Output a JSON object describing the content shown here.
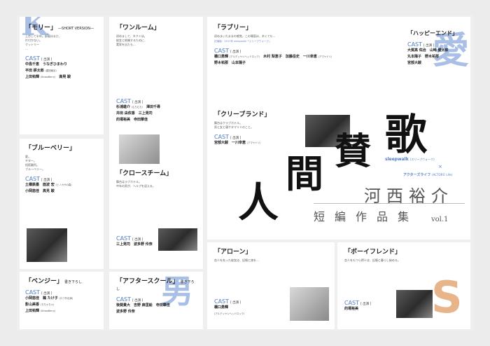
{
  "colors": {
    "accent": "#4f7cc8",
    "ghost_blue": "#a9bfe6",
    "ghost_peach": "#e8b48a"
  },
  "panels": {
    "mori": {
      "title": "「モリー」",
      "tag": "―SHORT VERSION―",
      "text": [
        "上京して半年。部屋はまだ、",
        "片付かない。",
        "クットリー",
        "…"
      ],
      "cast_label": "CAST",
      "cast_tag": "[ 出演 ]",
      "cast": [
        {
          "name": "中島千恵　うなぎひまわり"
        },
        {
          "name": "平田 耕太郎",
          "role": "(劇団東京)"
        },
        {
          "name": "上田祐輝",
          "role": "(StrawBerry)",
          "name2": "高晃 駿"
        }
      ]
    },
    "blueberry": {
      "title": "「ブルーベリー」",
      "text": [
        "夏。",
        "ギター。",
        "短距離列。",
        "ブルーベリー。"
      ],
      "cast_label": "CAST",
      "cast_tag": "[ 出演 ]",
      "cast": [
        {
          "name": "土橋鉄墨",
          "name2": "面波 宏",
          "role": "(ヒノカサの森)"
        },
        {
          "name": "小岡悠佳",
          "name2": "高見 駿"
        }
      ]
    },
    "benji": {
      "title": "「ベンジー」",
      "tag": "書き下ろし",
      "cast_label": "CAST",
      "cast_tag": "[ 出演 ]",
      "cast": [
        {
          "name": "小岡悠佳",
          "name2": "鵜 たけ子",
          "role": "(ロフ外出演)"
        },
        {
          "name": "影山美香",
          "role": "(ちちゃちゃ)"
        },
        {
          "name": "上田祐輝",
          "role": "(StrawBerry)"
        }
      ]
    },
    "wanroom": {
      "title": "「ワンルーム」",
      "text": [
        "初めまして、タクミは。",
        "彼女と結婚するために、",
        "実家を出たも…"
      ],
      "cast_label": "CAST",
      "cast_tag": "[ 出演 ]",
      "cast": [
        {
          "name": "杉浦雄介",
          "role": "(むちむち)",
          "name2": "澤田千尋"
        },
        {
          "name": "井田 由依香",
          "name2": "三上晃司"
        },
        {
          "name": "的場裕美",
          "name2": "寺田華佳"
        }
      ]
    },
    "closechime": {
      "title": "「クロースチーム」",
      "text": [
        "舞台はラブホテル。",
        "中年の男が、ヘルプを迎える。"
      ],
      "cast_label": "CAST",
      "cast_tag": "[ 出演 ]",
      "cast": [
        {
          "name": "三上晃司",
          "name2": "波多野 伶奈"
        }
      ]
    },
    "afterschool": {
      "title": "「アフタースクール」",
      "tag": "書き下ろし",
      "cast_label": "CAST",
      "cast_tag": "[ 出演 ]",
      "cast": [
        {
          "name": "後関貴大",
          "name2": "吉野 麻里絵",
          "name3": "寺田華佳"
        },
        {
          "name": "波多野 伶奈"
        }
      ]
    },
    "love": {
      "title": "「ラブリー」",
      "text": [
        "初めまいたままの感覚。この場面は、辛くても…"
      ],
      "note": "初演版：2017年 sleepwalk「スリープウォーク」",
      "cast_label": "CAST",
      "cast_tag": "[ 出演 ]",
      "cast": [
        {
          "name": "橋口勇輝",
          "role": "(アルデッヤシヘッドロック)",
          "name2": "木村 梨恵子",
          "name3": "加藤岳史",
          "name4": "一川幸恵",
          "role4": "(アマヤドリ)"
        },
        {
          "name": "野木祐那",
          "name2": "山本陽子"
        }
      ]
    },
    "cleveland": {
      "title": "「クリーブランド」",
      "text": [
        "舞台はクラブホテル。",
        "男と女と寝ケタマリミのこと。"
      ],
      "cast_label": "CAST",
      "cast_tag": "[ 出演 ]",
      "cast": [
        {
          "name": "宮部大駿",
          "name2": "一川幸恵",
          "role2": "(アマヤドリ)"
        }
      ]
    },
    "happyend": {
      "title": "「ハッピーエンド」",
      "tag": "書き下ろし",
      "cast_label": "CAST",
      "cast_tag": "[ 出演 ]",
      "cast": [
        {
          "name": "大賀高 佑治",
          "name2": "山崎 健太郎"
        },
        {
          "name": "丸本陽子",
          "name2": "野木祐那"
        },
        {
          "name": "宮部大駿"
        }
      ]
    },
    "alone": {
      "title": "「アローン」",
      "text": [
        "恋人を失った彼女は、記憶と旅を…"
      ],
      "cast_label": "CAST",
      "cast_tag": "[ 出演 ]",
      "cast": [
        {
          "name": "橋口勇輝",
          "role": "(アルデッヤシヘッドロック)"
        }
      ]
    },
    "boyfriend": {
      "title": "「ボーイフレンド」",
      "text": [
        "恋人をもつら得十は、記憶と暮らし始める。"
      ],
      "cast_label": "CAST",
      "cast_tag": "[ 出演 ]",
      "cast": [
        {
          "name": "的場裕美"
        }
      ]
    }
  },
  "hero": {
    "chars": [
      "人",
      "間",
      "賛",
      "歌"
    ],
    "author": "河西裕介",
    "subtitle": "短編作品集",
    "vol": "vol.1",
    "brand1": "sleepwalk",
    "brand1_sub": "(スリープウォーク)",
    "x": "×",
    "brand2": "アクターズライフ",
    "brand2_sub": "(ACTORS' Life)",
    "ghost_top": "愛",
    "ghost_bottom": "S",
    "ghost_left": "男",
    "ghost_left_top": "K"
  }
}
